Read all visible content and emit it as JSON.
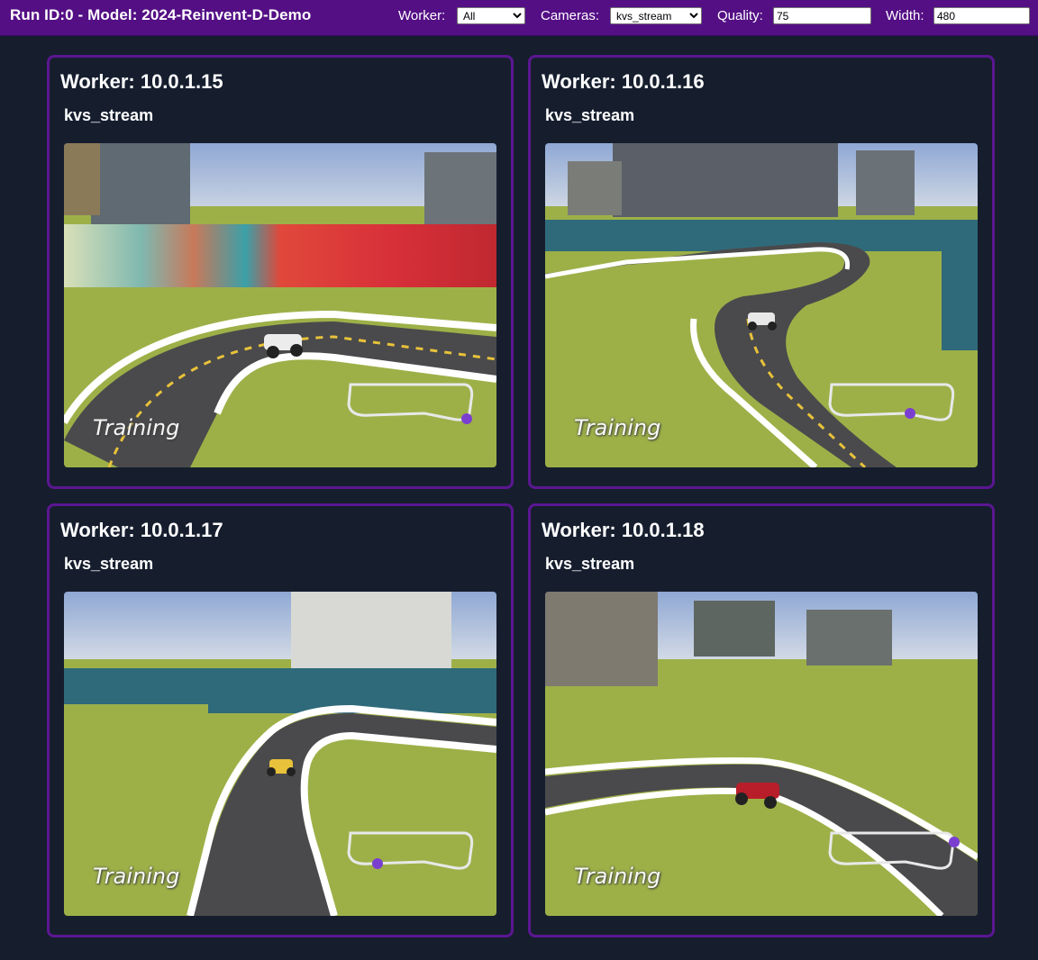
{
  "header": {
    "title": "Run ID:0 - Model: 2024-Reinvent-D-Demo",
    "worker_label": "Worker:",
    "worker_value": "All",
    "cameras_label": "Cameras:",
    "cameras_value": "kvs_stream",
    "quality_label": "Quality:",
    "quality_value": "75",
    "width_label": "Width:",
    "width_value": "480"
  },
  "workers": [
    {
      "title": "Worker: 10.0.1.15",
      "stream": "kvs_stream",
      "overlay": "Training"
    },
    {
      "title": "Worker: 10.0.1.16",
      "stream": "kvs_stream",
      "overlay": "Training"
    },
    {
      "title": "Worker: 10.0.1.17",
      "stream": "kvs_stream",
      "overlay": "Training"
    },
    {
      "title": "Worker: 10.0.1.18",
      "stream": "kvs_stream",
      "overlay": "Training"
    }
  ],
  "colors": {
    "header_bg": "#540f85",
    "card_border": "#5b1691",
    "page_bg": "#161e2e",
    "grass": "#9db048",
    "track": "#4a4a4c",
    "water": "#2f6a7a"
  }
}
